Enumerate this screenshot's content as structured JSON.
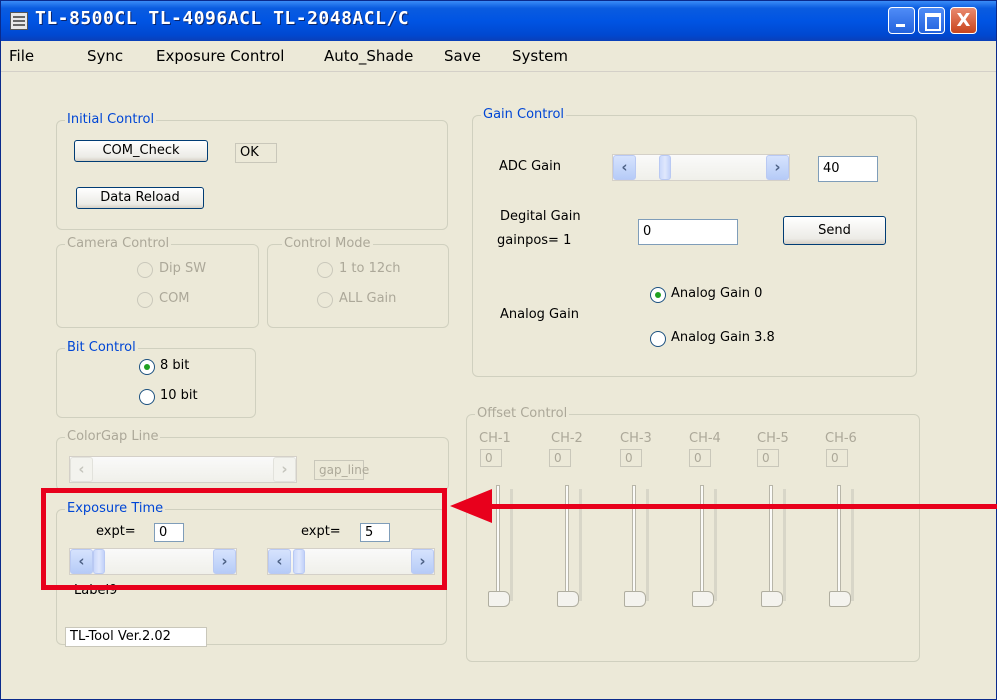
{
  "window": {
    "title": "TL-8500CL  TL-4096ACL  TL-2048ACL/C",
    "close_glyph": "X"
  },
  "menu": [
    "File",
    "Sync",
    "Exposure Control",
    "Auto_Shade",
    "Save",
    "System"
  ],
  "initial_control": {
    "legend": "Initial Control",
    "com_check_label": "COM_Check",
    "status": "OK",
    "data_reload_label": "Data Reload"
  },
  "camera_control": {
    "legend": "Camera Control",
    "options": [
      "Dip SW",
      "COM"
    ]
  },
  "control_mode": {
    "legend": "Control Mode",
    "options": [
      "1 to 12ch",
      "ALL Gain"
    ]
  },
  "bit_control": {
    "legend": "Bit Control",
    "options": [
      "8 bit",
      "10 bit"
    ],
    "selected": "8 bit"
  },
  "colorgap": {
    "legend": "ColorGap Line",
    "field": "gap_line"
  },
  "exposure_time": {
    "legend": "Exposure Time",
    "left_label": "expt=",
    "left_value": "0",
    "right_label": "expt=",
    "right_value": "5",
    "bottom_label": "Label9"
  },
  "version": "TL-Tool Ver.2.02",
  "gain_control": {
    "legend": "Gain Control",
    "adc_label": "ADC Gain",
    "adc_value": "40",
    "digital_label": "Degital Gain",
    "gainpos_label": "gainpos=  1",
    "digital_value": "0",
    "send_label": "Send",
    "analog_label": "Analog Gain",
    "analog_options": [
      "Analog Gain 0",
      "Analog Gain 3.8"
    ],
    "analog_selected": "Analog Gain 0"
  },
  "offset_control": {
    "legend": "Offset Control",
    "channels": [
      {
        "label": "CH-1",
        "value": "0"
      },
      {
        "label": "CH-2",
        "value": "0"
      },
      {
        "label": "CH-3",
        "value": "0"
      },
      {
        "label": "CH-4",
        "value": "0"
      },
      {
        "label": "CH-5",
        "value": "0"
      },
      {
        "label": "CH-6",
        "value": "0"
      }
    ]
  },
  "colors": {
    "highlight": "#e8001c",
    "titlebar": "#0054e3",
    "legend": "#0046d5"
  }
}
